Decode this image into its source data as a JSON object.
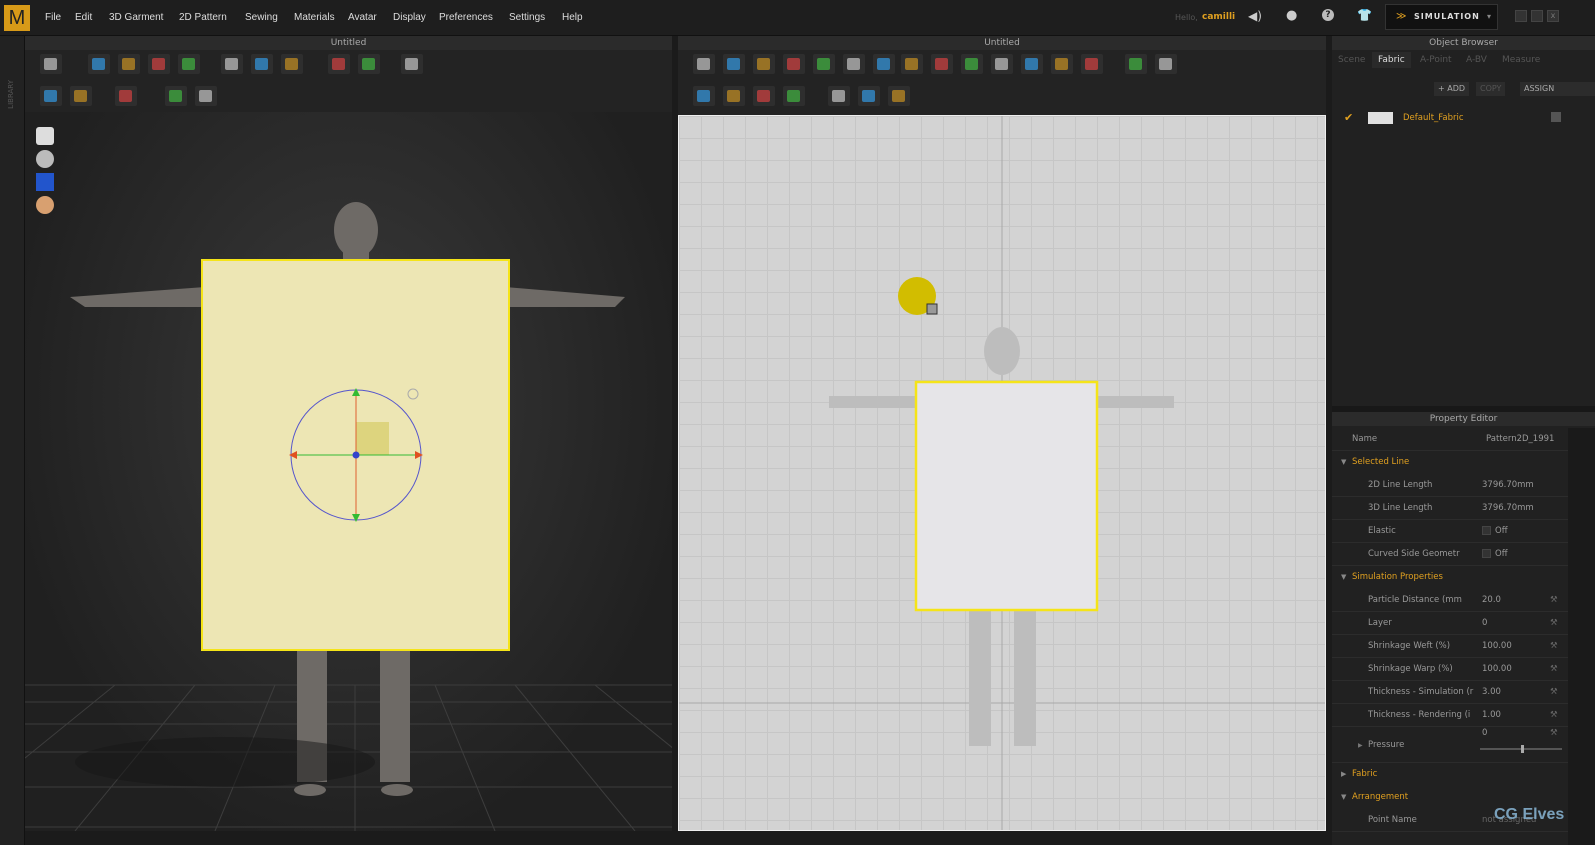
{
  "menubar": {
    "logo": "M",
    "items": [
      "File",
      "Edit",
      "3D Garment",
      "2D Pattern",
      "Sewing",
      "Materials",
      "Avatar",
      "Display",
      "Preferences",
      "Settings",
      "Help"
    ],
    "greeting": "Hello,",
    "user": "camilli",
    "mode": "SIMULATION",
    "icons": [
      "speaker-icon",
      "user-icon",
      "help-icon",
      "garment-plus-icon"
    ]
  },
  "sidebar": {
    "label": "LIBRARY"
  },
  "view3d": {
    "title": "Untitled"
  },
  "view2d": {
    "title": "Untitled"
  },
  "object_browser": {
    "title": "Object Browser",
    "tabs": [
      "Scene",
      "Fabric",
      "A-Point",
      "A-BV",
      "Measure"
    ],
    "active_tab": "Fabric",
    "buttons": {
      "add": "+ ADD",
      "copy": "COPY",
      "assign": "ASSIGN"
    },
    "items": [
      {
        "name": "Default_Fabric",
        "checked": true,
        "swatch": "#e0e0e0"
      }
    ]
  },
  "property_editor": {
    "title": "Property Editor",
    "name_label": "Name",
    "name_value": "Pattern2D_1991",
    "selected_line": {
      "title": "Selected Line",
      "rows": [
        {
          "k": "2D Line Length",
          "v": "3796.70mm"
        },
        {
          "k": "3D Line Length",
          "v": "3796.70mm"
        },
        {
          "k": "Elastic",
          "v": "Off"
        },
        {
          "k": "Curved Side Geometr",
          "v": "Off"
        }
      ]
    },
    "simulation": {
      "title": "Simulation Properties",
      "rows": [
        {
          "k": "Particle Distance (mm",
          "v": "20.0"
        },
        {
          "k": "Layer",
          "v": "0"
        },
        {
          "k": "Shrinkage Weft (%)",
          "v": "100.00"
        },
        {
          "k": "Shrinkage Warp (%)",
          "v": "100.00"
        },
        {
          "k": "Thickness - Simulation (r",
          "v": "3.00"
        },
        {
          "k": "Thickness - Rendering (i",
          "v": "1.00"
        }
      ],
      "pressure_label": "Pressure",
      "pressure_value": "0",
      "pressure_slider": 0.5
    },
    "fabric": "Fabric",
    "arrangement": "Arrangement",
    "point_name_label": "Point Name",
    "point_name_value": "not assigned"
  },
  "watermark": "CG Elves",
  "colors": {
    "accent": "#e0a020",
    "pattern_3d": "#ede6b4",
    "pattern_outline": "#f5e418"
  }
}
